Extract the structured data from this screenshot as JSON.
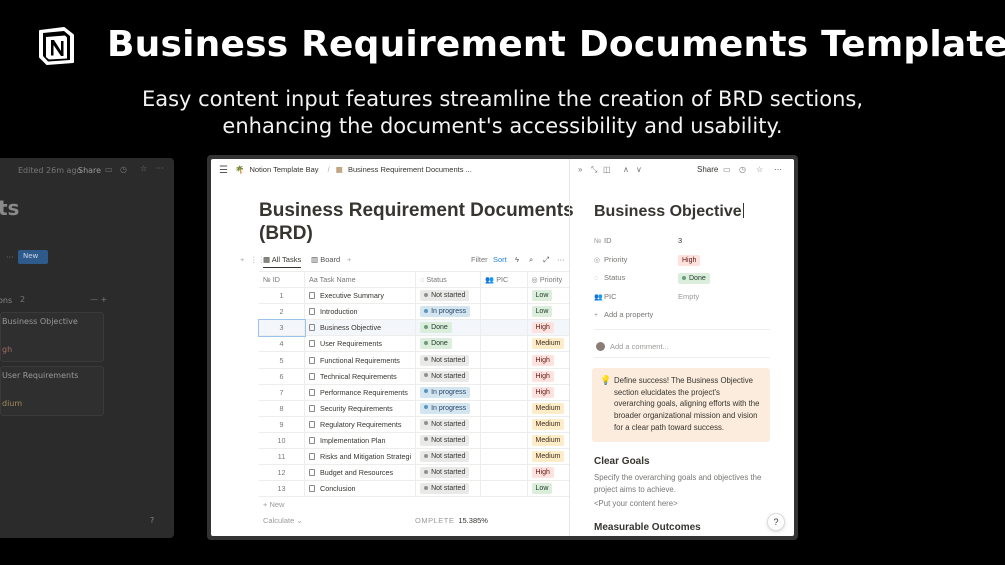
{
  "hero": {
    "title": "Business Requirement Documents Template",
    "subtitle_line1": "Easy content input features streamline the creation of BRD sections,",
    "subtitle_line2": "enhancing the document's accessibility and usability."
  },
  "background_window": {
    "edited": "Edited 26m ago",
    "share": "Share",
    "title_fragment": "ts",
    "new_button": "New",
    "group_label": "ons",
    "card1_title": "Business Objective",
    "card1_badge": "gh",
    "card2_title": "User Requirements",
    "card2_badge": "dium",
    "help": "?"
  },
  "breadcrumb": {
    "workspace": "Notion Template Bay",
    "page": "Business Requirement Documents ..."
  },
  "document": {
    "title_line1": "Business Requirement Documents",
    "title_line2": "(BRD)"
  },
  "views": {
    "all_tasks": "All Tasks",
    "board": "Board",
    "filter": "Filter",
    "sort": "Sort"
  },
  "table": {
    "columns": {
      "id": "ID",
      "task_name": "Task Name",
      "status": "Status",
      "pic": "PIC",
      "priority": "Priority"
    },
    "rows": [
      {
        "id": "1",
        "name": "Executive Summary",
        "status": "Not started",
        "priority": "Low"
      },
      {
        "id": "2",
        "name": "Introduction",
        "status": "In progress",
        "priority": "Low"
      },
      {
        "id": "3",
        "name": "Business Objective",
        "status": "Done",
        "priority": "High"
      },
      {
        "id": "4",
        "name": "User Requirements",
        "status": "Done",
        "priority": "Medium"
      },
      {
        "id": "5",
        "name": "Functional Requirements",
        "status": "Not started",
        "priority": "High"
      },
      {
        "id": "6",
        "name": "Technical Requirements",
        "status": "Not started",
        "priority": "High"
      },
      {
        "id": "7",
        "name": "Performance Requirements",
        "status": "In progress",
        "priority": "High"
      },
      {
        "id": "8",
        "name": "Security Requirements",
        "status": "In progress",
        "priority": "Medium"
      },
      {
        "id": "9",
        "name": "Regulatory Requirements",
        "status": "Not started",
        "priority": "Medium"
      },
      {
        "id": "10",
        "name": "Implementation Plan",
        "status": "Not started",
        "priority": "Medium"
      },
      {
        "id": "11",
        "name": "Risks and Mitigation Strategi",
        "status": "Not started",
        "priority": "Medium"
      },
      {
        "id": "12",
        "name": "Budget and Resources",
        "status": "Not started",
        "priority": "High"
      },
      {
        "id": "13",
        "name": "Conclusion",
        "status": "Not started",
        "priority": "Low"
      }
    ],
    "new_row": "+ New",
    "calculate": "Calculate",
    "complete_label": "OMPLETE",
    "complete_value": "15.385%"
  },
  "peek": {
    "share": "Share",
    "title": "Business Objective",
    "properties": {
      "id_label": "ID",
      "id_value": "3",
      "priority_label": "Priority",
      "priority_value": "High",
      "status_label": "Status",
      "status_value": "Done",
      "pic_label": "PIC",
      "pic_value": "Empty",
      "add_property": "Add a property"
    },
    "add_comment": "Add a comment...",
    "callout": "Define success! The Business Objective section elucidates the project's overarching goals, aligning efforts with the broader organizational mission and vision for a clear path toward success.",
    "section1_heading": "Clear Goals",
    "section1_text": "Specify the overarching goals and objectives the project aims to achieve.",
    "section1_placeholder": "<Put your content here>",
    "section2_heading": "Measurable Outcomes",
    "help": "?"
  },
  "colors": {
    "status_not_started": "#e9e9e7",
    "status_in_progress": "#d3e5ef",
    "status_done": "#dbeddb",
    "priority_low": "#dbeddb",
    "priority_medium": "#fdecc8",
    "priority_high": "#ffe2dd",
    "callout_bg": "#fbecdd"
  },
  "icons": [
    "notion-logo-icon",
    "menu-icon",
    "palm-tree-icon",
    "building-icon",
    "table-icon",
    "board-icon",
    "search-icon",
    "lightning-icon",
    "expand-icon",
    "more-icon",
    "comment-icon",
    "clock-icon",
    "star-icon",
    "lightbulb-icon",
    "help-icon"
  ]
}
